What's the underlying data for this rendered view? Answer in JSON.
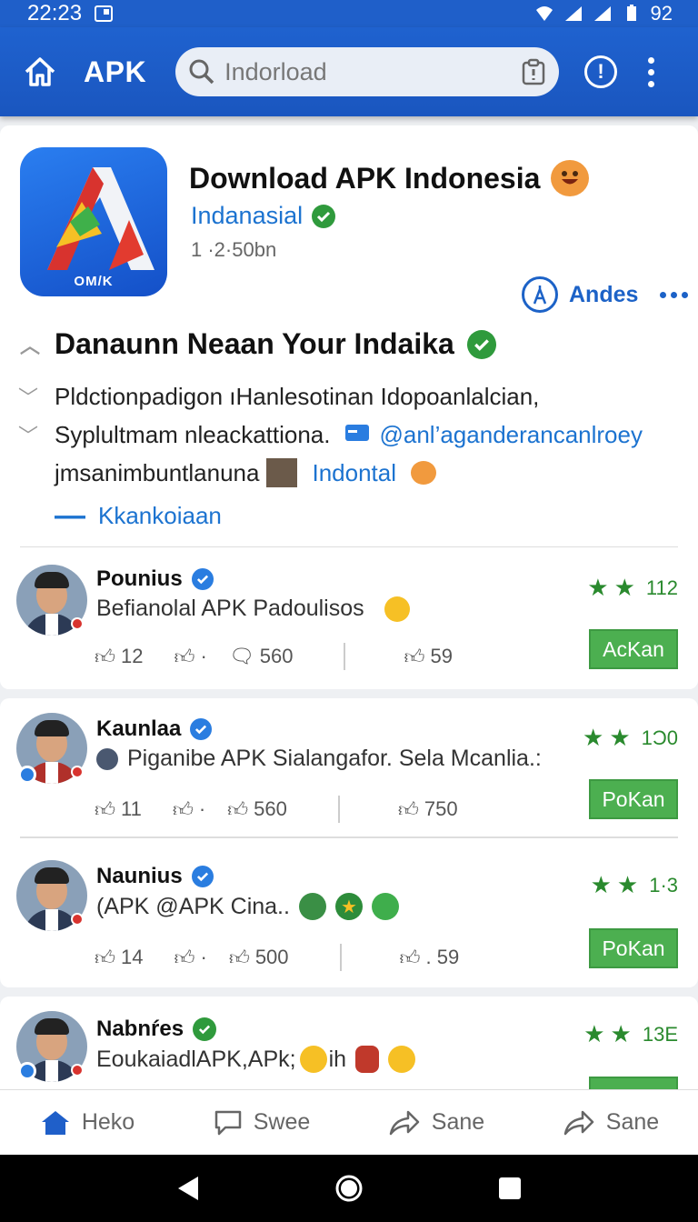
{
  "status": {
    "time": "22:23",
    "battery": "92"
  },
  "appbar": {
    "title": "APK",
    "search_placeholder": "Indorload"
  },
  "app": {
    "title": "Download APK Indonesia",
    "subtitle": "Indanasial",
    "size": "1 ·2·50bn",
    "icon_label": "OM/K",
    "author_label": "Andes"
  },
  "about": {
    "heading": "Danaunn Neaan Your Indaika",
    "line1": "Pldctionpadigon ıHanlesotinan Idopoanlalcian,",
    "line2_text": "Syplultmam nleackattiona.",
    "line2_link": "@anl’aganderancanlroey",
    "line3_text": "jmsanimbuntlanuna",
    "line3_link": "Indontal",
    "more_label": "Kkankoiaan"
  },
  "posts": [
    {
      "name": "Pounius",
      "text": "Befianolal APK Padoulisos",
      "rating": "112",
      "button": "AcKan",
      "likes": "12",
      "comments": "560",
      "shares": "59",
      "verified": "blue"
    },
    {
      "name": "Kaunlaa",
      "text": "Piganibe APK Sialangafor. Sela Mcanlia.:",
      "rating": "1Ɔ0",
      "button": "PoKan",
      "likes": "11",
      "comments": "560",
      "shares": "750",
      "verified": "blue"
    },
    {
      "name": "Naunius",
      "text": "(APK @APK Cina..",
      "rating": "1·3",
      "button": "PoKan",
      "likes": "14",
      "comments": "500",
      "shares": ". 59",
      "verified": "blue"
    },
    {
      "name": "Nabnŕes",
      "text": "EoukaiadlAPK,APk;",
      "text_tail": "ih",
      "rating": "13E",
      "button": "",
      "verified": "green"
    }
  ],
  "bottomnav": [
    "Heko",
    "Swee",
    "Sane",
    "Sane"
  ],
  "colors": {
    "primary": "#1f5fc9",
    "accent_green": "#4caf50",
    "link": "#1c73d0"
  }
}
